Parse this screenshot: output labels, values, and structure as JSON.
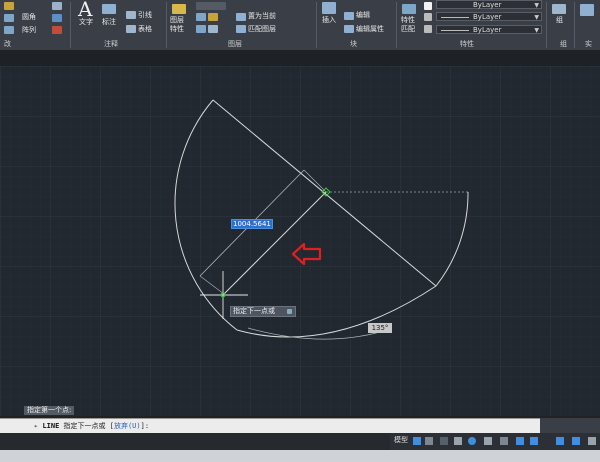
{
  "ribbon": {
    "modify": {
      "fillet": "圆角",
      "array": "阵列"
    },
    "annotation": {
      "text": "文字",
      "dimension": "标注",
      "leader": "引线",
      "table": "表格"
    },
    "layers": {
      "layer_properties": "图层\n特性",
      "set_current": "置为当前",
      "match_layer": "匹配图层"
    },
    "block": {
      "insert": "插入",
      "edit": "编辑",
      "edit_attributes": "编辑属性"
    },
    "properties": {
      "match_properties": "特性\n匹配",
      "bylayer_1": "ByLayer",
      "bylayer_2": "ByLayer",
      "bylayer_3": "ByLayer"
    },
    "groups": {
      "group": "组"
    },
    "panel_labels": {
      "modify": "改",
      "annotation": "注释",
      "layers": "图层",
      "block": "块",
      "properties": "特性",
      "groups": "组",
      "utilities": "实"
    },
    "accent": "#3f8ee0"
  },
  "canvas": {
    "dimension_input": "1004.5641",
    "tooltip": "指定下一点或",
    "angle": "135°",
    "background": "#212830",
    "line_color": "#d8d8d8",
    "arrow_color": "#e02020",
    "cursor_color": "#33cc33"
  },
  "command": {
    "history": "指定第一个点:",
    "prompt_prefix": "LINE",
    "prompt_text": "指定下一点或",
    "option_open": "[",
    "option_label": "放弃",
    "option_key": "(U)",
    "option_close": "]:"
  },
  "status": {
    "model_tab": "模型"
  }
}
